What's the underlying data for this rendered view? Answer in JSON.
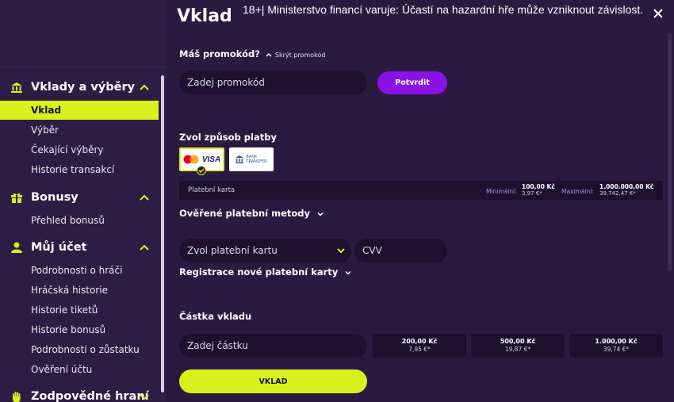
{
  "header": {
    "title": "Vklad",
    "warning": "18+| Ministerstvo financí varuje: Účastí na hazardní hře může vzniknout závislost."
  },
  "sidebar": {
    "sections": [
      {
        "title": "Vklady a výběry",
        "icon": "bank-icon",
        "items": [
          "Vklad",
          "Výběr",
          "Čekající výběry",
          "Historie transakcí"
        ]
      },
      {
        "title": "Bonusy",
        "icon": "gift-icon",
        "items": [
          "Přehled bonusů"
        ]
      },
      {
        "title": "Můj účet",
        "icon": "user-icon",
        "items": [
          "Podrobnosti o hráči",
          "Hráčská historie",
          "Historie tiketů",
          "Historie bonusů",
          "Podrobnosti o zůstatku",
          "Ověření účtu"
        ]
      },
      {
        "title": "Zodpovědné hraní",
        "icon": "hand-icon",
        "items": []
      }
    ],
    "active_item": "Vklad"
  },
  "promo": {
    "question": "Máš promokód?",
    "hide_label": "Skrýt promokód",
    "placeholder": "Zadej promokód",
    "confirm_label": "Potvrdit"
  },
  "payment": {
    "label": "Zvol způsob platby",
    "methods": [
      {
        "name": "visa-mastercard",
        "text": "VISA",
        "selected": true
      },
      {
        "name": "bank-transfer",
        "text_1": "BANK",
        "text_2": "TRANSFER",
        "selected": false
      }
    ],
    "method_name": "Platební karta",
    "min_label": "Minimální:",
    "min_value": "100,00 Kč",
    "min_eur": "3,97 €*",
    "max_label": "Maximální:",
    "max_value": "1.000.000,00 Kč",
    "max_eur": "39.742,47 €*",
    "verified_label": "Ověřené platební metody",
    "card_select": "Zvol platební kartu",
    "cvv_placeholder": "CVV",
    "register_label": "Registrace nové platební karty"
  },
  "amount": {
    "label": "Částka vkladu",
    "placeholder": "Zadej částku",
    "presets": [
      {
        "value": "200,00 Kč",
        "eur": "7,95 €*"
      },
      {
        "value": "500,00 Kč",
        "eur": "19,87 €*"
      },
      {
        "value": "1.000,00 Kč",
        "eur": "39,74 €*"
      }
    ]
  },
  "submit_label": "VKLAD",
  "colors": {
    "accent": "#d6f21c",
    "purple": "#8a12e6",
    "background": "#2a1a40",
    "sidebar": "#2d1d45",
    "input": "#1d1130"
  }
}
